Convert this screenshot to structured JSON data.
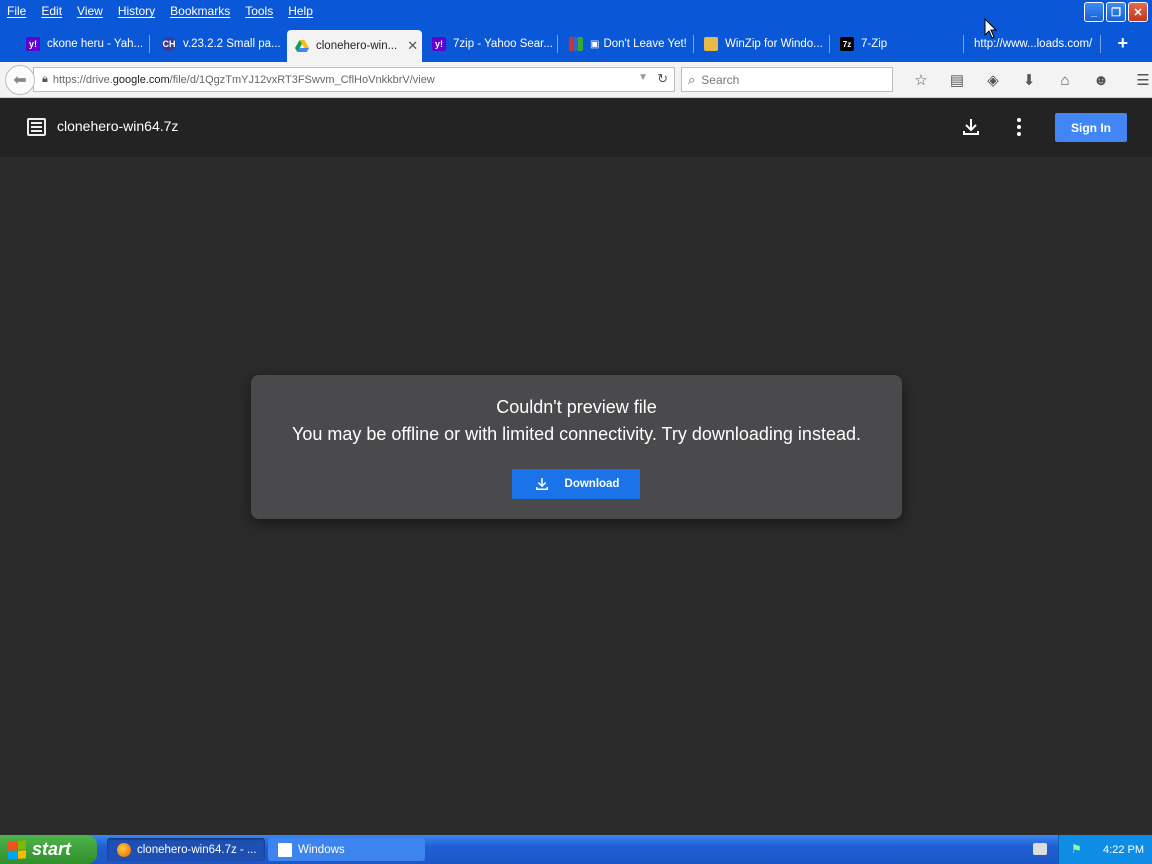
{
  "menubar": {
    "items": [
      "File",
      "Edit",
      "View",
      "History",
      "Bookmarks",
      "Tools",
      "Help"
    ]
  },
  "tabs": [
    {
      "label": "ckone heru - Yah...",
      "icon": "yahoo-icon",
      "active": false
    },
    {
      "label": "v.23.2.2 Small pa...",
      "icon": "clonehero-icon",
      "active": false
    },
    {
      "label": "clonehero-win...",
      "icon": "google-drive-icon",
      "active": true
    },
    {
      "label": "7zip - Yahoo Sear...",
      "icon": "yahoo-icon",
      "active": false
    },
    {
      "label": "Don't Leave Yet!",
      "icon": "winrar-icon",
      "active": false
    },
    {
      "label": "WinZip for Windo...",
      "icon": "winzip-icon",
      "active": false
    },
    {
      "label": "7-Zip",
      "icon": "7zip-icon",
      "active": false
    },
    {
      "label": "http://www...loads.com/",
      "icon": "",
      "active": false
    }
  ],
  "navbar": {
    "url_prefix": "https://drive.",
    "url_domain": "google.com",
    "url_path": "/file/d/1QgzTmYJ12vxRT3FSwvm_CflHoVnkkbrV/view",
    "search_placeholder": "Search"
  },
  "drive": {
    "filename": "clonehero-win64.7z",
    "sign_in_label": "Sign In"
  },
  "dialog": {
    "title": "Couldn't preview file",
    "message": "You may be offline or with limited connectivity. Try downloading instead.",
    "download_label": "Download"
  },
  "taskbar": {
    "start_label": "start",
    "tasks": [
      {
        "label": "clonehero-win64.7z - ...",
        "active": true
      },
      {
        "label": "Windows",
        "active": false
      }
    ],
    "clock": "4:22 PM"
  },
  "colors": {
    "xp_blue": "#0a58d8",
    "drive_dark": "#2b2b2b",
    "button_blue": "#1a73e8",
    "sign_in_blue": "#4285f4"
  }
}
